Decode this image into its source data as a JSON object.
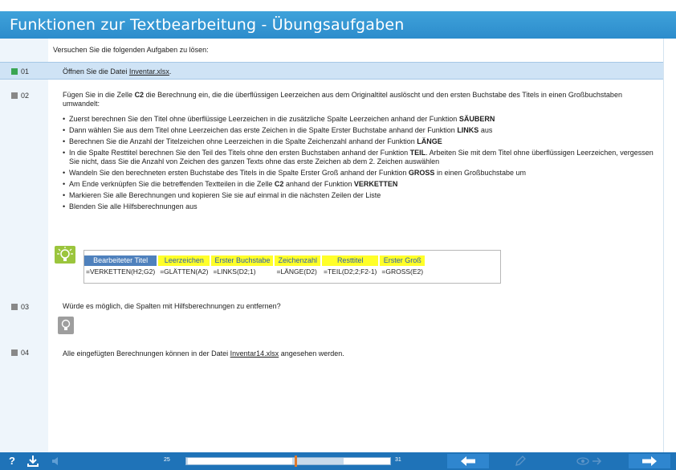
{
  "header": {
    "title": "Funktionen zur Textbearbeitung - Übungsaufgaben"
  },
  "intro": "Versuchen Sie die folgenden Aufgaben zu lösen:",
  "tasks": [
    {
      "num": "01",
      "text_before": "Öffnen Sie die Datei ",
      "link": "Inventar.xlsx",
      "text_after": "."
    },
    {
      "num": "02",
      "text_a": "Fügen Sie in die Zelle ",
      "text_b": "C2",
      "text_c": " die Berechnung ein, die die überflüssigen Leerzeichen aus dem Originaltitel auslöscht und den ersten Buchstabe des Titels in einen Großbuchstaben umwandelt:"
    },
    {
      "num": "03",
      "text": "Würde es möglich, die Spalten mit Hilfsberechnungen zu entfernen?"
    },
    {
      "num": "04",
      "text_before": "Alle eingefügten Berechnungen können in der Datei ",
      "link": "Inventar14.xlsx",
      "text_after": " angesehen werden."
    }
  ],
  "bullets": [
    {
      "a": "Zuerst berechnen Sie den Titel ohne überflüssige Leerzeichen in die zusätzliche Spalte Leerzeichen anhand der Funktion ",
      "b": "SÄUBERN",
      "c": ""
    },
    {
      "a": "Dann wählen Sie aus dem Titel ohne Leerzeichen das erste Zeichen in die Spalte Erster Buchstabe anhand der Funktion ",
      "b": "LINKS",
      "c": " aus"
    },
    {
      "a": "Berechnen Sie die Anzahl der Titelzeichen ohne Leerzeichen in die Spalte Zeichenzahl anhand der Funktion ",
      "b": "LÄNGE",
      "c": ""
    },
    {
      "a": "In die Spalte Resttitel berechnen Sie den Teil des Titels ohne den ersten Buchstaben anhand der Funktion ",
      "b": "TEIL",
      "c": ". Arbeiten Sie mit dem Titel ohne überflüssigen Leerzeichen, vergessen Sie nicht, dass Sie die Anzahl von Zeichen des ganzen Texts ohne das erste Zeichen ab dem 2. Zeichen auswählen"
    },
    {
      "a": "Wandeln Sie den berechneten ersten Buchstabe des Titels in die Spalte Erster Groß anhand der Funktion ",
      "b": "GROSS",
      "c": " in einen Großbuchstabe um"
    },
    {
      "a": "Am Ende verknüpfen Sie die betreffenden Textteilen in die Zelle ",
      "b": "C2",
      "c": " anhand der Funktion ",
      "d": "VERKETTEN"
    },
    {
      "a": "Markieren Sie alle Berechnungen und kopieren Sie sie auf einmal in die nächsten Zeilen der Liste",
      "b": "",
      "c": ""
    },
    {
      "a": "Blenden Sie alle Hilfsberechnungen aus",
      "b": "",
      "c": ""
    }
  ],
  "example_table": {
    "headers": [
      "Bearbeiteter Titel",
      "Leerzeichen",
      "Erster Buchstabe",
      "Zeichenzahl",
      "Resttitel",
      "Erster Groß"
    ],
    "formulas": [
      "=VERKETTEN(H2;G2)",
      "=GLÄTTEN(A2)",
      "=LINKS(D2;1)",
      "=LÄNGE(D2)",
      "=TEIL(D2;2;F2-1)",
      "=GROSS(E2)"
    ]
  },
  "footer": {
    "help": "?",
    "page_start": "25",
    "page_end": "31",
    "progress": 0.53
  },
  "colors": {
    "header": "#2c8ccc",
    "highlight_row": "#cfe3f5",
    "footer": "#1f73b8",
    "yellow": "#ffff29",
    "blue_header": "#4f81bd"
  }
}
